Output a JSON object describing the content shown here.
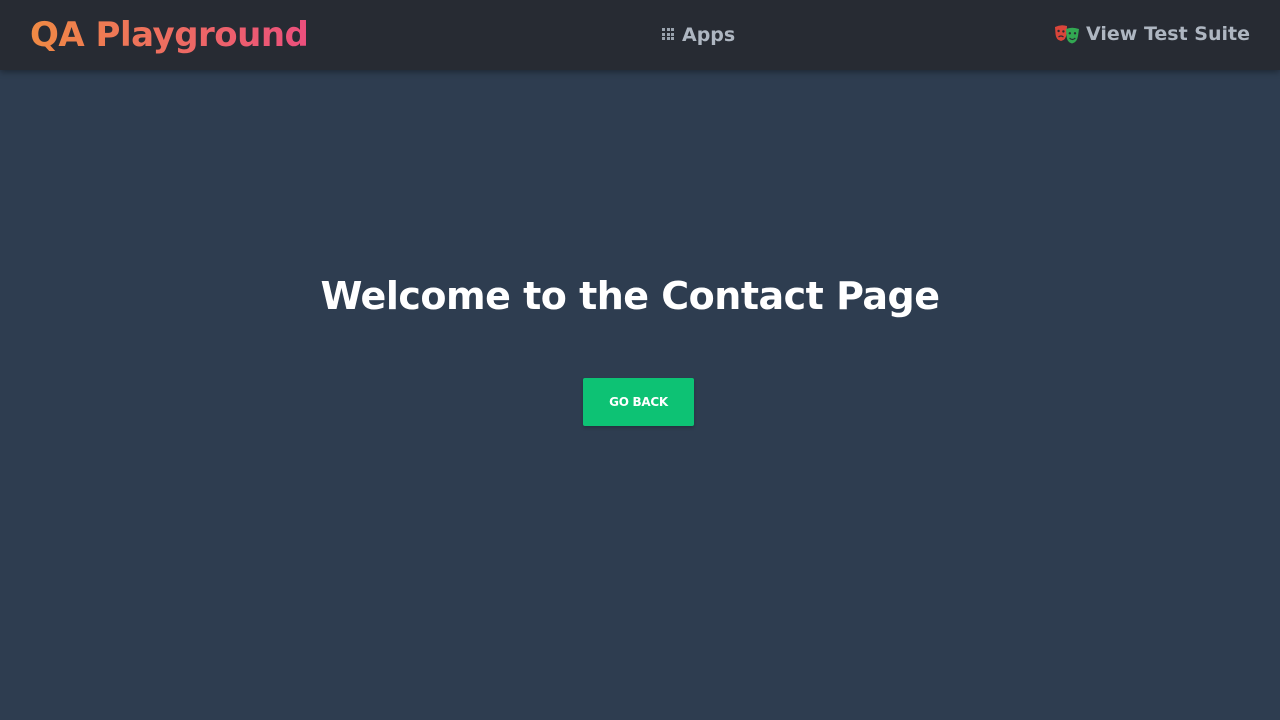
{
  "header": {
    "brand": "QA Playground",
    "nav": {
      "apps_label": "Apps",
      "apps_icon": "grid-icon",
      "suite_label": "View Test Suite",
      "suite_icon": "theater-masks-icon"
    }
  },
  "main": {
    "heading": "Welcome to the Contact Page",
    "back_button": "GO BACK"
  },
  "colors": {
    "navbar_bg": "#272b33",
    "page_bg": "#2e3d50",
    "brand_gradient_start": "#ef8a44",
    "brand_gradient_end": "#ec4f7d",
    "nav_text": "#aeb6c1",
    "button_bg": "#0dc274",
    "heading_text": "#ffffff"
  }
}
